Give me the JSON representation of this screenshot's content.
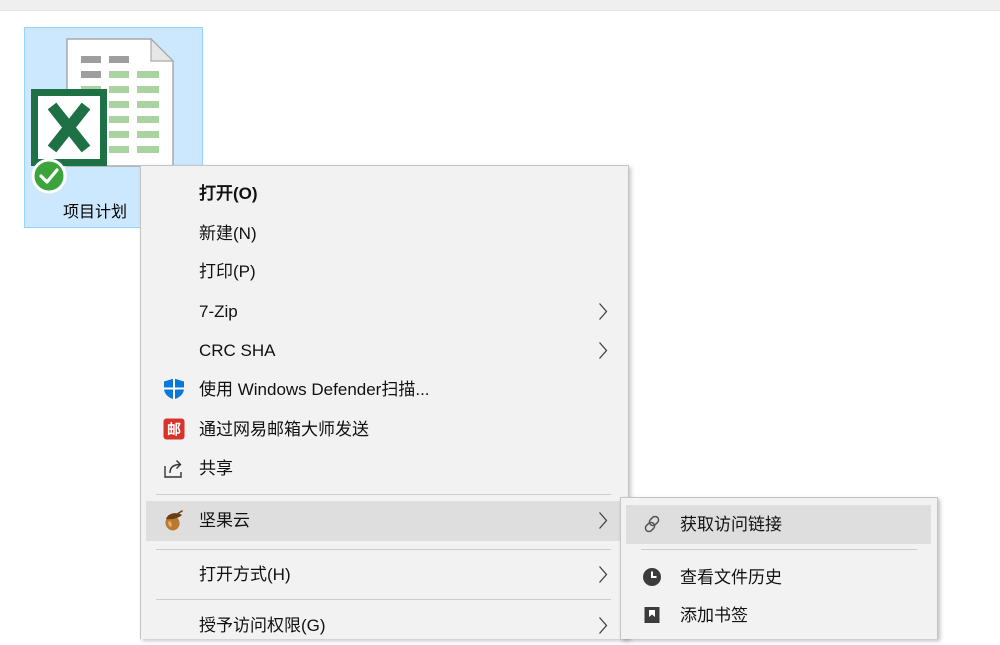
{
  "window": {
    "top_strip_color": "#efefef",
    "background": "#ffffff"
  },
  "file": {
    "name": "项目计划",
    "icon": "excel-spreadsheet-icon",
    "status_icon": "synced-check-icon",
    "selected": true
  },
  "context_menu": {
    "items": [
      {
        "label": "打开(O)",
        "bold": true
      },
      {
        "label": "新建(N)"
      },
      {
        "label": "打印(P)"
      },
      {
        "label": "7-Zip",
        "has_submenu": true
      },
      {
        "label": "CRC SHA",
        "has_submenu": true
      },
      {
        "label": "使用 Windows Defender扫描...",
        "icon": "windows-defender-shield-icon"
      },
      {
        "label": "通过网易邮箱大师发送",
        "icon": "netease-mail-master-icon",
        "icon_text": "邮"
      },
      {
        "label": "共享",
        "icon": "share-icon"
      },
      {
        "label": "坚果云",
        "icon": "nutstore-acorn-icon",
        "has_submenu": true,
        "highlighted": true
      },
      {
        "label": "打开方式(H)",
        "has_submenu": true
      },
      {
        "label": "授予访问权限(G)",
        "has_submenu": true
      }
    ]
  },
  "nutstore_submenu": {
    "items": [
      {
        "label": "获取访问链接",
        "icon": "link-icon",
        "highlighted": true
      },
      {
        "label": "查看文件历史",
        "icon": "history-clock-icon"
      },
      {
        "label": "添加书签",
        "icon": "bookmark-icon"
      }
    ]
  },
  "colors": {
    "menu_background": "#f2f2f2",
    "menu_border": "#c4c4c4",
    "highlight": "#dedede",
    "selection_fill": "#cce8ff",
    "selection_border": "#99d1ff",
    "excel_green": "#1e7145",
    "defender_blue": "#0a78d6",
    "mail_red": "#d8322a",
    "acorn_brown": "#b97a2f"
  }
}
